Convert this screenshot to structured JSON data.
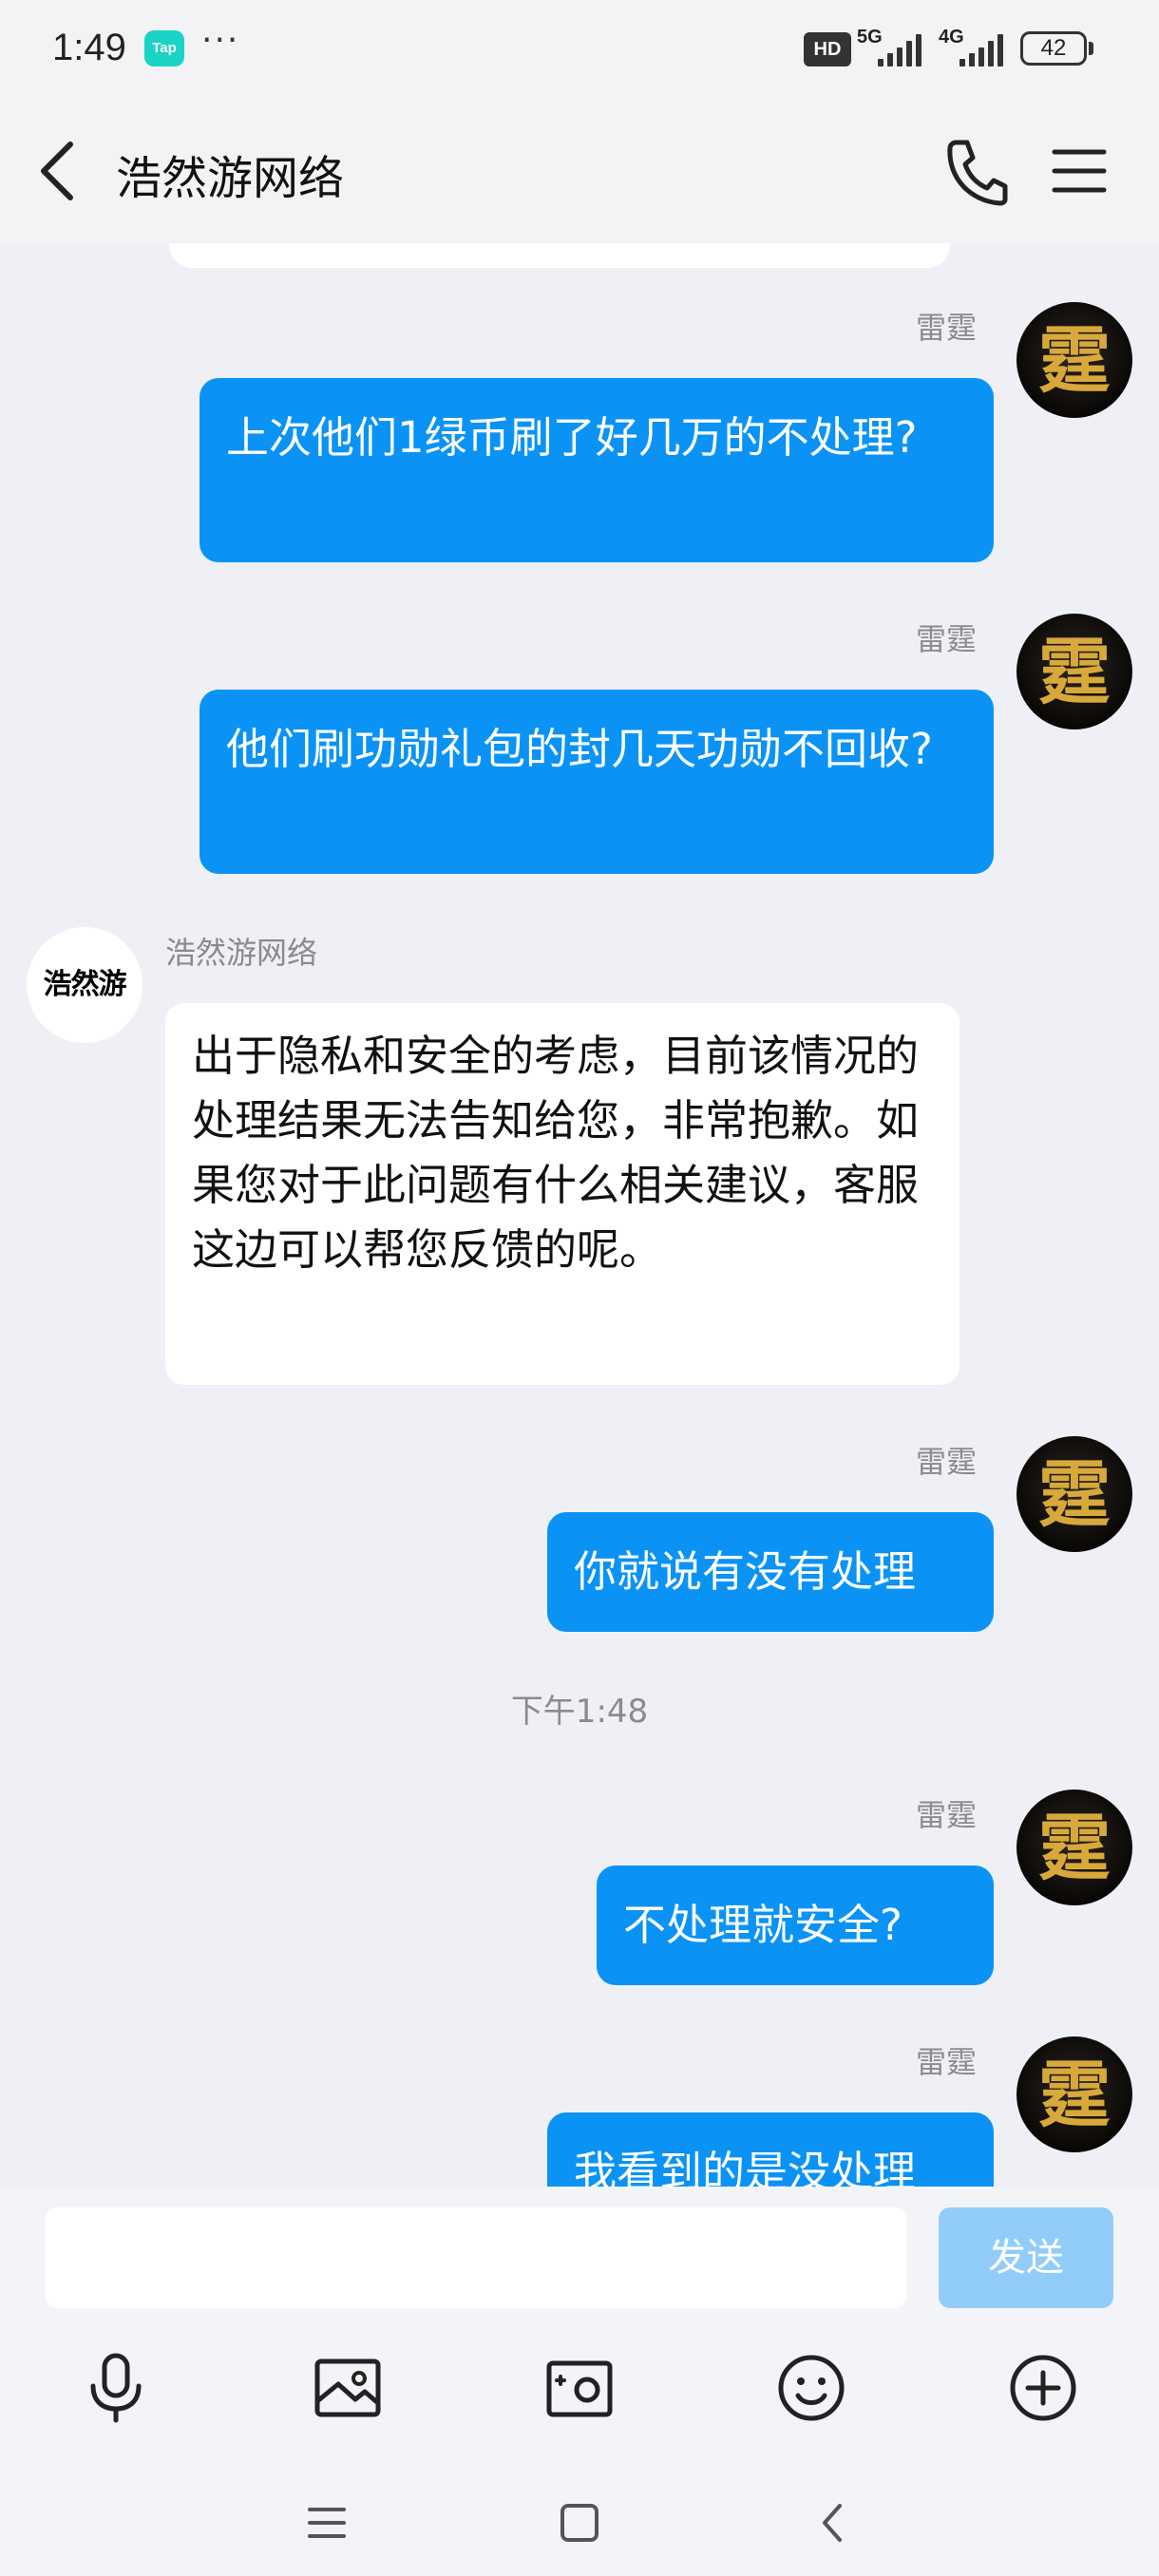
{
  "status_bar": {
    "time": "1:49",
    "tap_label": "Tap",
    "more": "···",
    "hd_label": "HD",
    "net1": "5G",
    "net2": "4G",
    "battery": "42"
  },
  "header": {
    "title": "浩然游网络"
  },
  "messages": [
    {
      "sender": "雷霆",
      "side": "me",
      "text": "上次他们1绿币刷了好几万的不处理?"
    },
    {
      "sender": "雷霆",
      "side": "me",
      "text": "他们刷功勋礼包的封几天功勋不回收?"
    },
    {
      "sender": "浩然游网络",
      "side": "them",
      "text": "出于隐私和安全的考虑，目前该情况的处理结果无法告知给您，非常抱歉。如果您对于此问题有什么相关建议，客服这边可以帮您反馈的呢。"
    },
    {
      "sender": "雷霆",
      "side": "me",
      "text": "你就说有没有处理"
    },
    {
      "sender": "雷霆",
      "side": "me",
      "text": "不处理就安全?"
    },
    {
      "sender": "雷霆",
      "side": "me",
      "text": "我看到的是没处理"
    }
  ],
  "timestamp": "下午1:48",
  "avatar_them_text": "浩然游",
  "avatar_me_glyph": "霆",
  "input": {
    "value": "",
    "send_label": "发送"
  },
  "colors": {
    "bubble_me": "#0a93f5",
    "send_disabled": "#92cdf9",
    "background": "#eef0f5"
  }
}
